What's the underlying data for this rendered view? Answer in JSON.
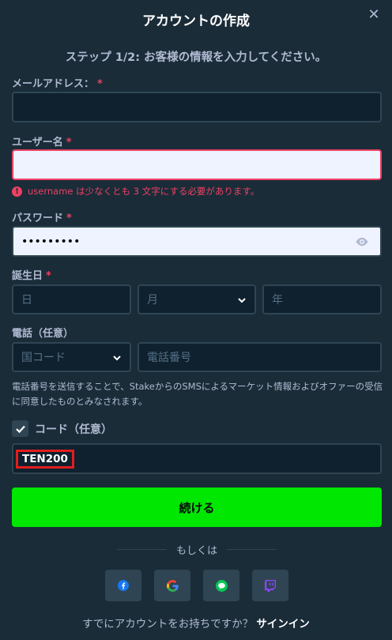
{
  "modal": {
    "title": "アカウントの作成",
    "subtitle": "ステップ 1/2: お客様の情報を入力してください。"
  },
  "email": {
    "label": "メールアドレス：",
    "required": "*",
    "value": ""
  },
  "username": {
    "label": "ユーザー名",
    "required": "*",
    "value": "",
    "error": "username は少なくとも 3 文字にする必要があります。"
  },
  "password": {
    "label": "パスワード",
    "required": "*",
    "value": "•••••••••"
  },
  "birthdate": {
    "label": "誕生日",
    "required": "*",
    "day_placeholder": "日",
    "month_placeholder": "月",
    "year_placeholder": "年"
  },
  "phone": {
    "label": "電話（任意）",
    "country_placeholder": "国コード",
    "number_placeholder": "電話番号",
    "note": "電話番号を送信することで、StakeからのSMSによるマーケット情報およびオファーの受信に同意したものとみなされます。"
  },
  "code": {
    "label": "コード（任意）",
    "checked": true,
    "value": "TEN200"
  },
  "continue_label": "続ける",
  "or_label": "もしくは",
  "social_icons": [
    "facebook-icon",
    "google-icon",
    "line-icon",
    "twitch-icon"
  ],
  "footer": {
    "prompt": "すでにアカウントをお持ちですか？",
    "signin_label": "サインイン"
  },
  "colors": {
    "background": "#1a2c38",
    "input_bg": "#0f212e",
    "border": "#2f4553",
    "error": "#ed4163",
    "accent_green": "#00e701",
    "highlight_red": "#e21d1d"
  }
}
